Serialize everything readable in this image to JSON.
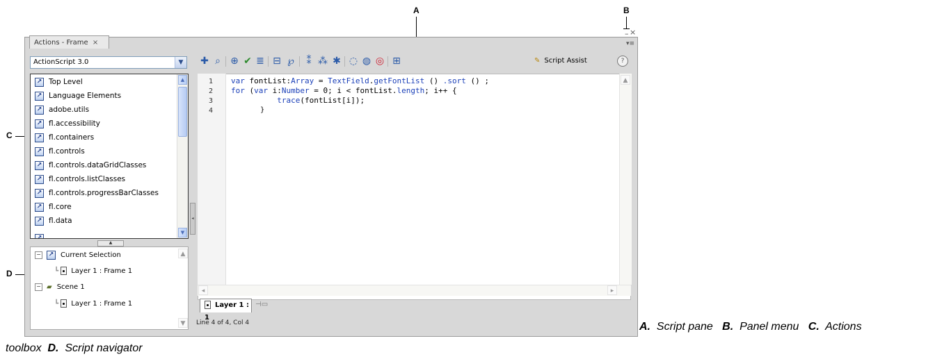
{
  "callouts": {
    "a": "A",
    "b": "B",
    "c": "C",
    "d": "D"
  },
  "panel": {
    "tab_label": "Actions - Frame",
    "tab_close": "×",
    "minimize": "–",
    "close": "×",
    "menu_icon": "▾≡"
  },
  "toolbox": {
    "language": "ActionScript 3.0",
    "items": [
      "Top Level",
      "Language Elements",
      "adobe.utils",
      "fl.accessibility",
      "fl.containers",
      "fl.controls",
      "fl.controls.dataGridClasses",
      "fl.controls.listClasses",
      "fl.controls.progressBarClasses",
      "fl.core",
      "fl.data"
    ]
  },
  "navigator": {
    "current_selection": "Current Selection",
    "current_frame": "Layer 1 : Frame 1",
    "scene": "Scene 1",
    "scene_frame": "Layer 1 : Frame 1"
  },
  "toolbar": {
    "script_assist": "Script Assist",
    "help": "?"
  },
  "script": {
    "line_numbers": [
      "1",
      "2",
      "3",
      "4"
    ],
    "line1_kw": "var",
    "line1_a": " fontList:",
    "line1_type": "Array",
    "line1_b": " = ",
    "line1_class": "TextField",
    "line1_c": ".",
    "line1_method": "getFontList",
    "line1_d": " () ",
    "line1_sort": ".sort",
    "line1_e": " () ;",
    "line2_kw": "for",
    "line2_a": " (",
    "line2_kw2": "var",
    "line2_b": " i:",
    "line2_type": "Number",
    "line2_c": " = 0; i < fontList.",
    "line2_prop": "length",
    "line2_d": "; i++ {",
    "line3_indent": "          ",
    "line3_func": "trace",
    "line3_a": "(fontList[i]);",
    "line4": "       }"
  },
  "layer_tab": "Layer 1 : 1",
  "status": "Line 4 of 4, Col 4",
  "caption": {
    "a_label": "A.",
    "a_text": "Script pane",
    "b_label": "B.",
    "b_text": "Panel menu",
    "c_label": "C.",
    "c_text": "Actions",
    "c_text2": "toolbox",
    "d_label": "D.",
    "d_text": "Script navigator"
  }
}
